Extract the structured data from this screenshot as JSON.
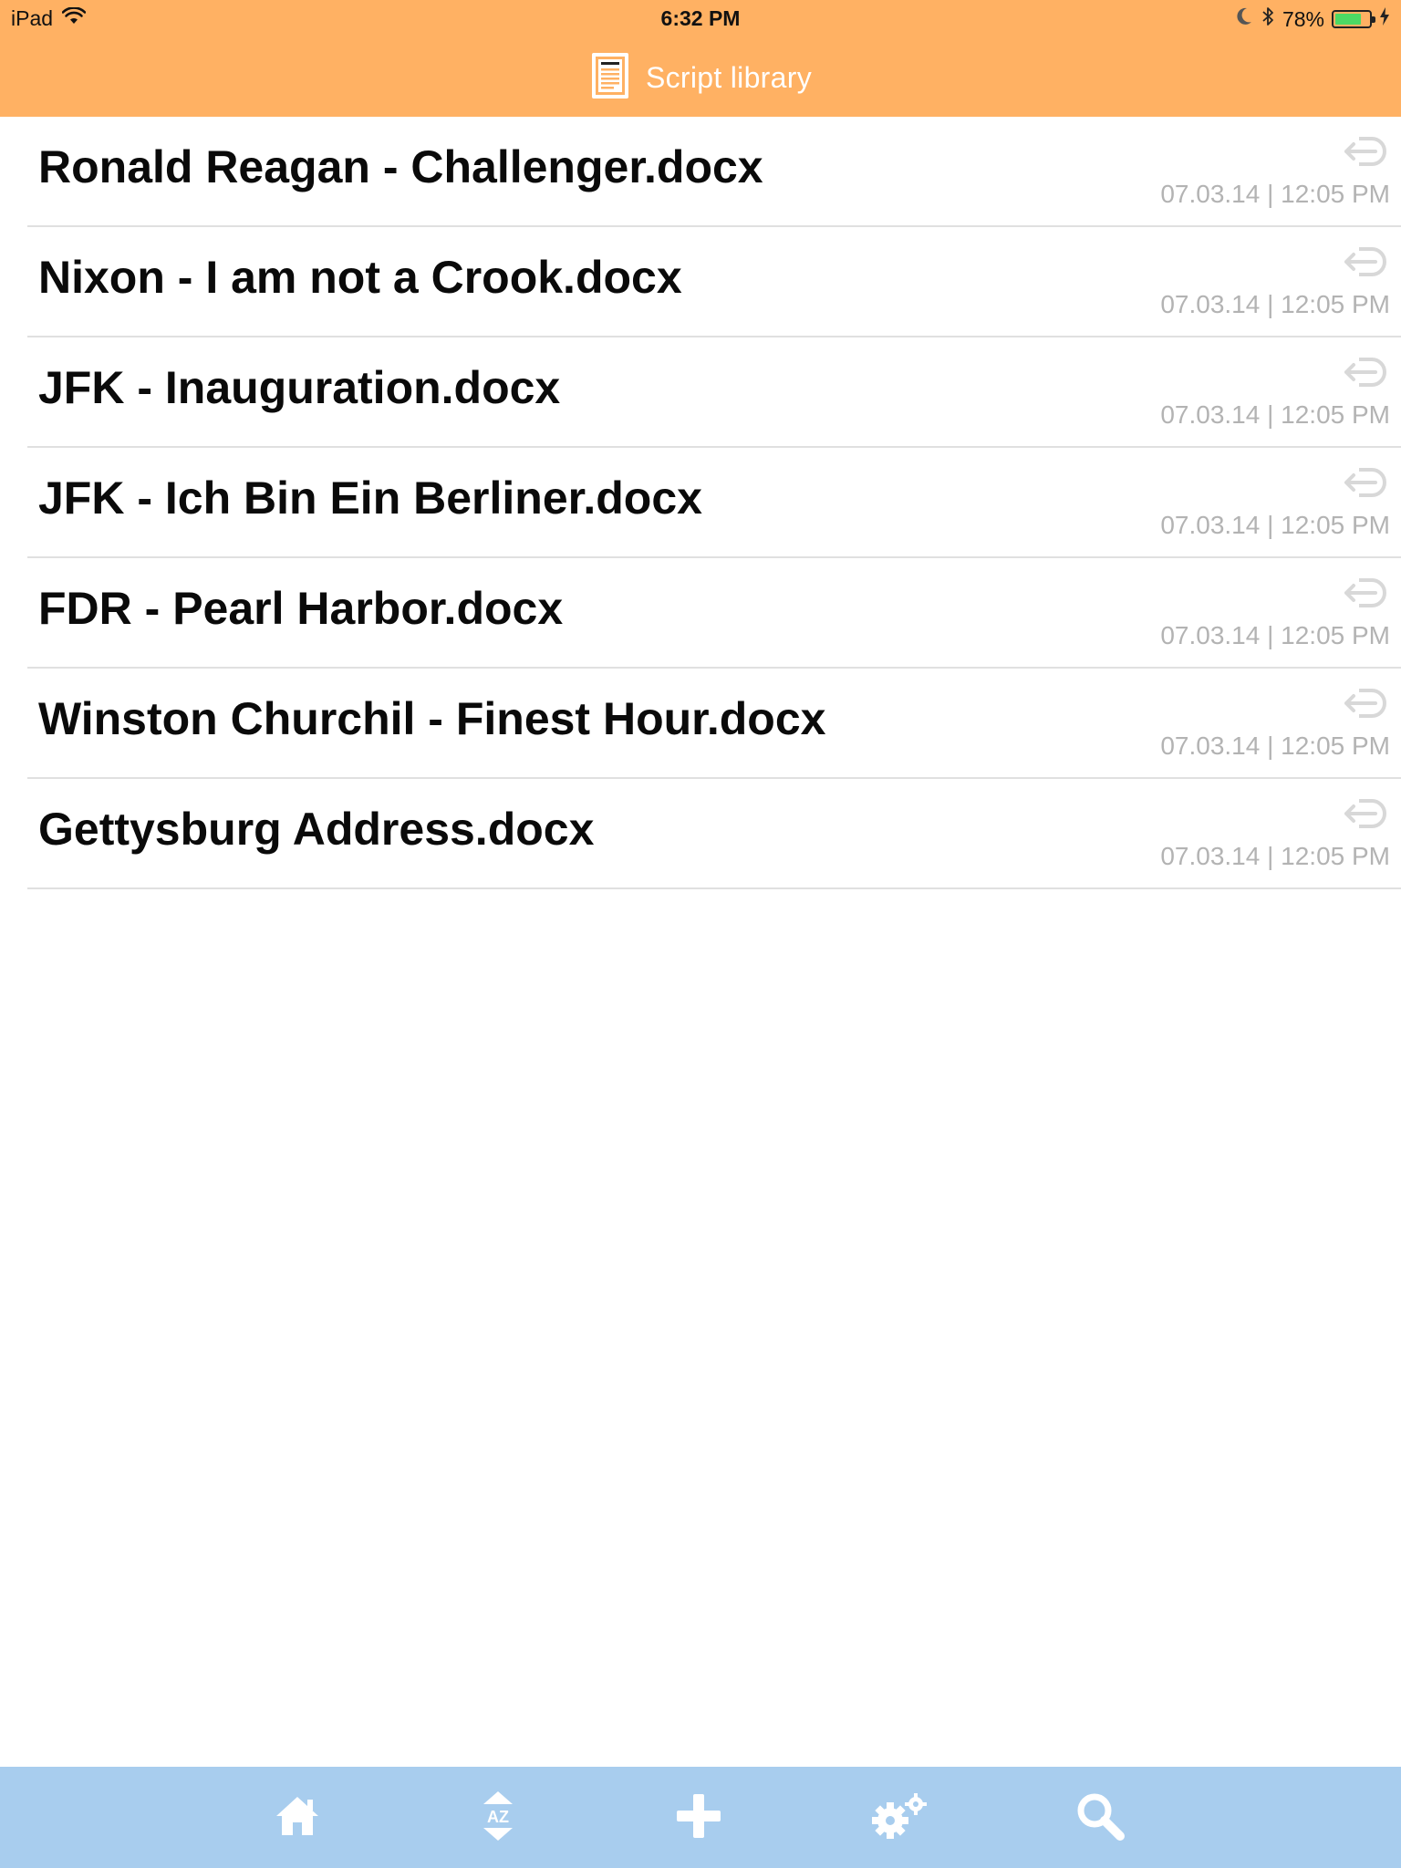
{
  "status_bar": {
    "device": "iPad",
    "time": "6:32 PM",
    "battery_text": "78%",
    "battery_level": 0.78,
    "battery_color": "#4cd964"
  },
  "nav": {
    "title": "Script library",
    "icon": "document-icon",
    "background": "#ffb163"
  },
  "files": [
    {
      "name": "Ronald Reagan - Challenger.docx",
      "date": "07.03.14 | 12:05 PM"
    },
    {
      "name": "Nixon - I am not a Crook.docx",
      "date": "07.03.14 | 12:05 PM"
    },
    {
      "name": "JFK - Inauguration.docx",
      "date": "07.03.14 | 12:05 PM"
    },
    {
      "name": "JFK - Ich Bin Ein Berliner.docx",
      "date": "07.03.14 | 12:05 PM"
    },
    {
      "name": "FDR - Pearl Harbor.docx",
      "date": "07.03.14 | 12:05 PM"
    },
    {
      "name": "Winston Churchil - Finest Hour.docx",
      "date": "07.03.14 | 12:05 PM"
    },
    {
      "name": "Gettysburg Address.docx",
      "date": "07.03.14 | 12:05 PM"
    }
  ],
  "toolbar": {
    "background": "#a8cdee",
    "sort_label": "AZ",
    "icons": [
      "home-icon",
      "sort-az-icon",
      "add-icon",
      "settings-icon",
      "search-icon"
    ]
  }
}
